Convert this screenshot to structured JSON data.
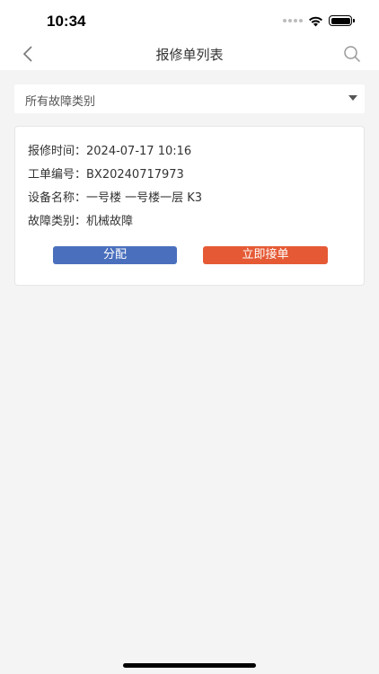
{
  "status_bar": {
    "time": "10:34"
  },
  "navbar": {
    "title": "报修单列表",
    "back_icon": "chevron-left-icon",
    "search_icon": "search-icon"
  },
  "filter": {
    "selected": "所有故障类别"
  },
  "card": {
    "fields": [
      {
        "label": "报修时间：",
        "value": "2024-07-17 10:16"
      },
      {
        "label": "工单编号：",
        "value": "BX20240717973"
      },
      {
        "label": "设备名称：",
        "value": "一号楼 一号楼一层 K3"
      },
      {
        "label": "故障类别：",
        "value": "机械故障"
      }
    ],
    "assign_label": "分配",
    "accept_label": "立即接单"
  },
  "colors": {
    "assign": "#4a6fbd",
    "accept": "#e55a35",
    "background": "#f4f4f4"
  }
}
